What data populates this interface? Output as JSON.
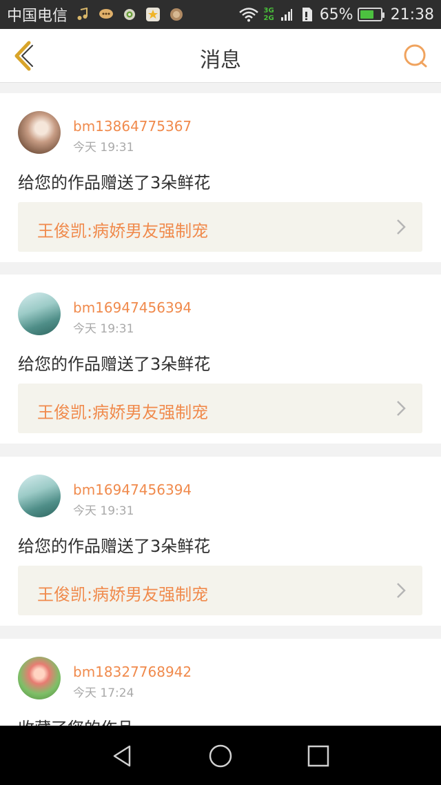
{
  "status_bar": {
    "carrier": "中国电信",
    "net_3g": "3G",
    "net_2g": "2G",
    "battery_percent": "65%",
    "time": "21:38",
    "battery_level": 0.7,
    "icons": [
      "music-icon",
      "chat-bubble-icon",
      "target-icon",
      "star-icon",
      "coin-icon",
      "wifi-icon",
      "signal-icon",
      "sim-icon",
      "battery-icon"
    ]
  },
  "header": {
    "title": "消息",
    "back_icon": "chevron-left-icon",
    "search_icon": "search-icon"
  },
  "messages": [
    {
      "username": "bm13864775367",
      "time": "今天 19:31",
      "text": "给您的作品赠送了3朵鲜花",
      "work_title": "王俊凯:病娇男友强制宠"
    },
    {
      "username": "bm16947456394",
      "time": "今天 19:31",
      "text": "给您的作品赠送了3朵鲜花",
      "work_title": "王俊凯:病娇男友强制宠"
    },
    {
      "username": "bm16947456394",
      "time": "今天 19:31",
      "text": "给您的作品赠送了3朵鲜花",
      "work_title": "王俊凯:病娇男友强制宠"
    },
    {
      "username": "bm18327768942",
      "time": "今天 17:24",
      "text": "收藏了您的作品"
    }
  ],
  "colors": {
    "accent": "#f08a4c",
    "header_icon": "#f0a35e",
    "back_icon": "#d8a42a",
    "work_bg": "#f4f3ec"
  },
  "navbar": {
    "icons": [
      "back-triangle-icon",
      "home-circle-icon",
      "recents-square-icon"
    ]
  }
}
